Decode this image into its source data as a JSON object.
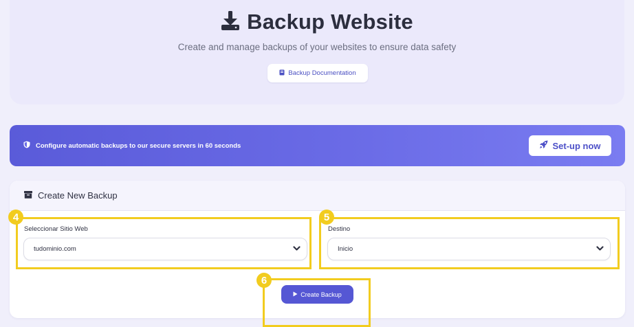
{
  "header": {
    "title": "Backup Website",
    "subtitle": "Create and manage backups of your websites to ensure data safety",
    "doc_button_label": "Backup Documentation"
  },
  "banner": {
    "text": "Configure automatic backups to our secure servers in 60 seconds",
    "setup_label": "Set-up now"
  },
  "card": {
    "title": "Create New Backup",
    "site_field": {
      "label": "Seleccionar Sitio Web",
      "value": "tudominio.com"
    },
    "dest_field": {
      "label": "Destino",
      "value": "Inicio"
    },
    "create_label": "Create Backup"
  },
  "annotations": {
    "site": "4",
    "dest": "5",
    "create": "6"
  },
  "colors": {
    "accent": "#5557d4",
    "highlight": "#f2cc1f",
    "background": "#f0effb"
  },
  "icons": {
    "title": "download-icon",
    "doc": "book-icon",
    "banner": "shield-icon",
    "setup": "rocket-icon",
    "card": "archive-icon",
    "select": "chevron-down-icon",
    "create": "play-icon"
  }
}
